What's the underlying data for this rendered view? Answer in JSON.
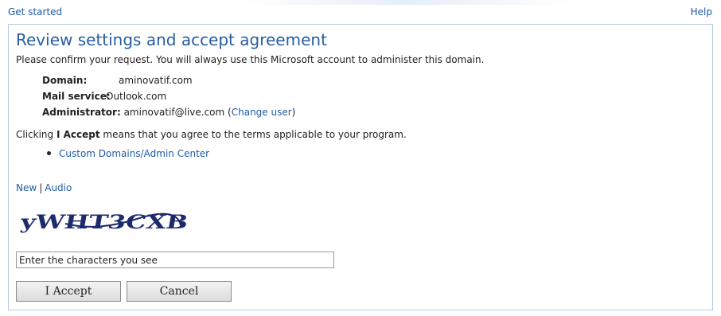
{
  "top": {
    "get_started": "Get started",
    "help": "Help"
  },
  "panel": {
    "title": "Review settings and accept agreement",
    "intro": "Please confirm your request. You will always use this Microsoft account to administer this domain.",
    "domain_label": "Domain:",
    "domain_value": "aminovatif.com",
    "mail_label": "Mail service:",
    "mail_value": "Outlook.com",
    "admin_label": "Administrator:",
    "admin_value": "aminovatif@live.com",
    "change_user_open": "(",
    "change_user": "Change user",
    "change_user_close": ")",
    "accept_prefix": "Clicking ",
    "accept_bold": "I Accept",
    "accept_suffix": " means that you agree to the terms applicable to your program.",
    "terms_link": "Custom Domains/Admin Center"
  },
  "captcha": {
    "new_label": "New",
    "separator": "|",
    "audio_label": "Audio",
    "image_text": "yWHT3CXB",
    "input_placeholder": "Enter the characters you see"
  },
  "buttons": {
    "accept": "I Accept",
    "cancel": "Cancel"
  },
  "colors": {
    "link": "#1f5aa8",
    "title": "#275da0",
    "border": "#b3cbe0",
    "captcha": "#1e2a6e"
  }
}
